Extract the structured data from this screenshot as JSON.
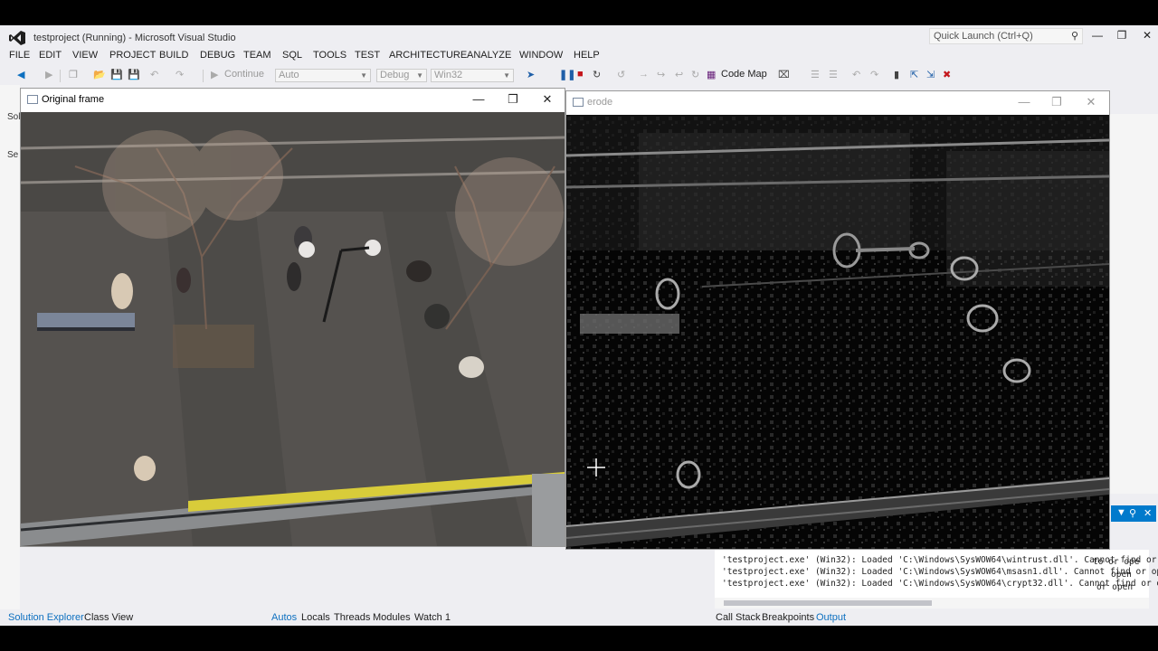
{
  "app": {
    "title": "testproject (Running) - Microsoft Visual Studio",
    "quick_launch": "Quick Launch (Ctrl+Q)",
    "min": "—",
    "max": "❐",
    "close": "✕"
  },
  "menu": [
    "FILE",
    "EDIT",
    "VIEW",
    "PROJECT",
    "BUILD",
    "DEBUG",
    "TEAM",
    "SQL",
    "TOOLS",
    "TEST",
    "ARCHITECTURE",
    "ANALYZE",
    "WINDOW",
    "HELP"
  ],
  "toolbar": {
    "continue": "Continue",
    "config1": "Auto",
    "config2": "Debug",
    "platform": "Win32",
    "code_map": "Code Map"
  },
  "side_labels": {
    "a": "Sol",
    "b": "Se"
  },
  "windows": {
    "original": {
      "title": "Original frame"
    },
    "erode": {
      "title": "erode"
    }
  },
  "bottom_tabs": {
    "left": [
      "Solution Explorer",
      "Class View"
    ],
    "middle": [
      "Autos",
      "Locals",
      "Threads",
      "Modules",
      "Watch 1"
    ],
    "right": [
      "Call Stack",
      "Breakpoints",
      "Output"
    ]
  },
  "output_lines": [
    "to or ope",
    "open",
    "or open",
    "'testproject.exe' (Win32): Loaded 'C:\\Windows\\SysWOW64\\wintrust.dll'. Cannot find or ope",
    "'testproject.exe' (Win32): Loaded 'C:\\Windows\\SysWOW64\\msasn1.dll'. Cannot find or open",
    "'testproject.exe' (Win32): Loaded 'C:\\Windows\\SysWOW64\\crypt32.dll'. Cannot find or ope"
  ],
  "colors": {
    "accent": "#007acc",
    "vs_purple": "#68217a"
  }
}
